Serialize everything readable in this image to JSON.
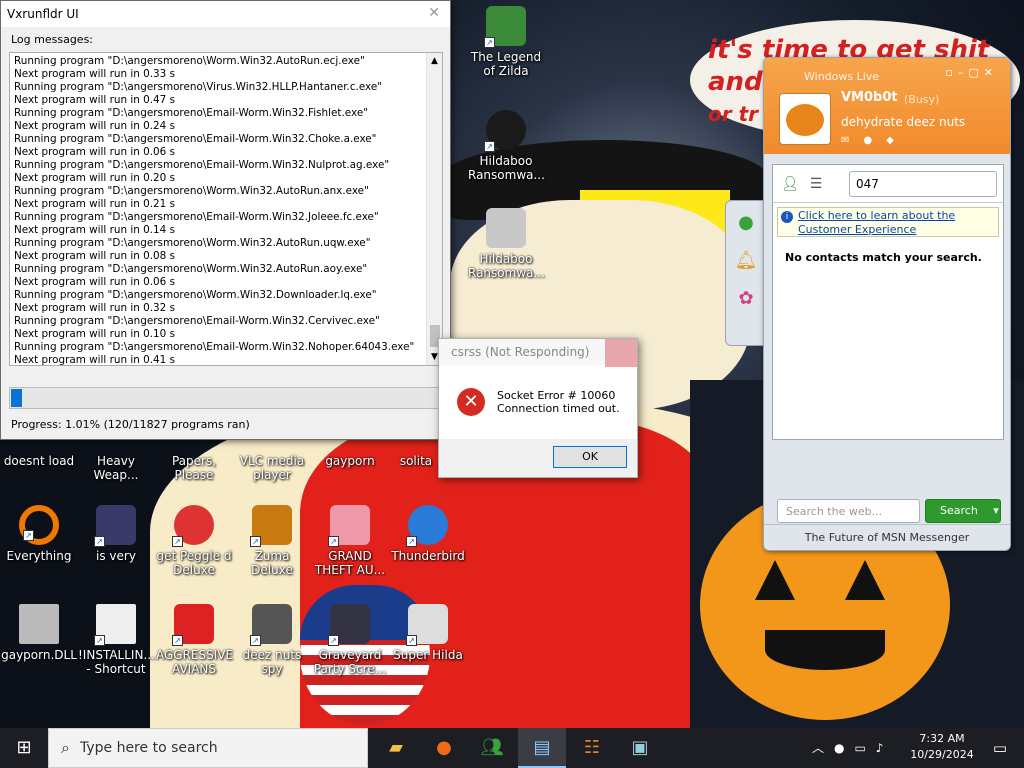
{
  "vx_window": {
    "title": "Vxrunfldr UI",
    "close": "✕",
    "log_label": "Log messages:",
    "log": [
      "Running program \"D:\\angersmoreno\\Worm.Win32.AutoRun.ecj.exe\"",
      "Next program will run in 0.33 s",
      "Running program \"D:\\angersmoreno\\Virus.Win32.HLLP.Hantaner.c.exe\"",
      "Next program will run in 0.47 s",
      "Running program \"D:\\angersmoreno\\Email-Worm.Win32.Fishlet.exe\"",
      "Next program will run in 0.24 s",
      "Running program \"D:\\angersmoreno\\Email-Worm.Win32.Choke.a.exe\"",
      "Next program will run in 0.06 s",
      "Running program \"D:\\angersmoreno\\Email-Worm.Win32.Nulprot.ag.exe\"",
      "Next program will run in 0.20 s",
      "Running program \"D:\\angersmoreno\\Worm.Win32.AutoRun.anx.exe\"",
      "Next program will run in 0.21 s",
      "Running program \"D:\\angersmoreno\\Email-Worm.Win32.Joleee.fc.exe\"",
      "Next program will run in 0.14 s",
      "Running program \"D:\\angersmoreno\\Worm.Win32.AutoRun.uqw.exe\"",
      "Next program will run in 0.08 s",
      "Running program \"D:\\angersmoreno\\Worm.Win32.AutoRun.aoy.exe\"",
      "Next program will run in 0.06 s",
      "Running program \"D:\\angersmoreno\\Worm.Win32.Downloader.lq.exe\"",
      "Next program will run in 0.32 s",
      "Running program \"D:\\angersmoreno\\Email-Worm.Win32.Cervivec.exe\"",
      "Next program will run in 0.10 s",
      "Running program \"D:\\angersmoreno\\Email-Worm.Win32.Nohoper.64043.exe\"",
      "Next program will run in 0.41 s"
    ],
    "progress_text": "Progress: 1.01% (120/11827 programs ran)",
    "progress_fraction": 0.0101
  },
  "dialog": {
    "title": "csrss (Not Responding)",
    "line1": "Socket Error # 10060",
    "line2": "Connection timed out.",
    "ok": "OK"
  },
  "messenger": {
    "brand": "Windows Live",
    "username": "VM0b0t",
    "status": "(Busy)",
    "personal_message": "dehydrate deez nuts",
    "search_value": "047",
    "info_link": "Click here to learn about the Customer Experience",
    "no_match": "No contacts match your search.",
    "web_placeholder": "Search the web...",
    "search_button": "Search",
    "footer": "The Future of MSN Messenger"
  },
  "wallpaper_text": {
    "line1": "it's time to get shit",
    "line2": "and",
    "line3": "or tr"
  },
  "desktop_icons": [
    {
      "label": "The Legend of Zilda",
      "color": "#3a8a3a"
    },
    {
      "label": "Hildaboo Ransomwa...",
      "color": "#1a1a1a"
    },
    {
      "label": "Hildaboo Ransomwa...",
      "color": "#c8c8c8"
    },
    {
      "label": "doesnt load",
      "color": "#2a6fc9"
    },
    {
      "label": "Heavy Weap...",
      "color": "#777"
    },
    {
      "label": "Papers, Please",
      "color": "#7a4a2a"
    },
    {
      "label": "VLC media player",
      "color": "#f08a00"
    },
    {
      "label": "gayporn",
      "color": "#b33"
    },
    {
      "label": "solita",
      "color": "#2a7a4a"
    },
    {
      "label": "Everything",
      "color": "#f07800"
    },
    {
      "label": "is very",
      "color": "#3a3a6a"
    },
    {
      "label": "get Peggle d Deluxe",
      "color": "#d33"
    },
    {
      "label": "Zuma Deluxe",
      "color": "#c87a10"
    },
    {
      "label": "GRAND THEFT AU...",
      "color": "#e9a"
    },
    {
      "label": "Thunderbird",
      "color": "#2a7ad8"
    },
    {
      "label": "gayporn.DLL",
      "color": "#bbb"
    },
    {
      "label": "!INSTALLIN... - Shortcut",
      "color": "#eee"
    },
    {
      "label": "AGGRESSIVE AVIANS",
      "color": "#d22"
    },
    {
      "label": "deez nuts spy",
      "color": "#555"
    },
    {
      "label": "Graveyard Party Scre...",
      "color": "#334"
    },
    {
      "label": "Super Hilda",
      "color": "#ddd"
    }
  ],
  "taskbar": {
    "search_placeholder": "Type here to search",
    "time": "7:32 AM",
    "date": "10/29/2024"
  }
}
